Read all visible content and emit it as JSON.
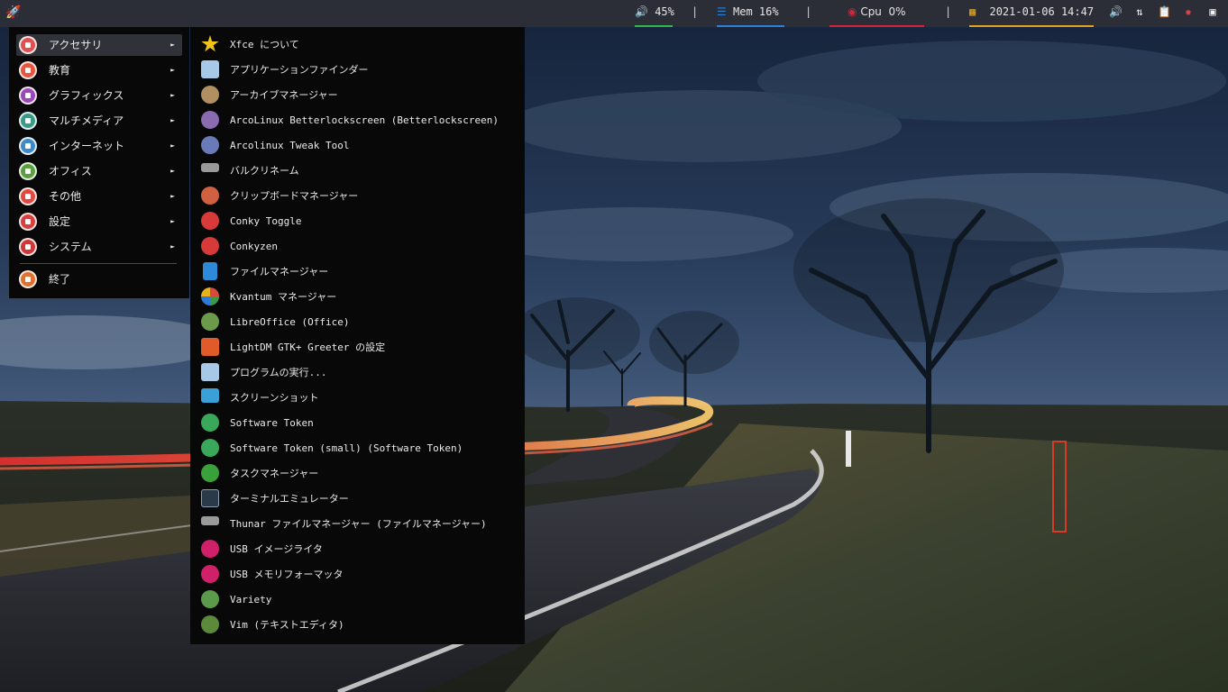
{
  "panel": {
    "volume": "45%",
    "memory": "Mem 16%",
    "cpu": "Cpu  0%",
    "clock": "2021-01-06 14:47",
    "separator": "|",
    "colors": {
      "volume": "#2dbb4a",
      "memory": "#2e7fd6",
      "cpu": "#d3243a",
      "clock": "#e0a220"
    }
  },
  "categories": [
    {
      "label": "アクセサリ",
      "icon": "accessories-icon",
      "color": "#e05050"
    },
    {
      "label": "教育",
      "icon": "education-icon",
      "color": "#e8553e"
    },
    {
      "label": "グラフィックス",
      "icon": "graphics-icon",
      "color": "#9a4ab8"
    },
    {
      "label": "マルチメディア",
      "icon": "multimedia-icon",
      "color": "#3a9a8a"
    },
    {
      "label": "インターネット",
      "icon": "internet-icon",
      "color": "#3e8ac8"
    },
    {
      "label": "オフィス",
      "icon": "office-icon",
      "color": "#5aa040"
    },
    {
      "label": "その他",
      "icon": "other-icon",
      "color": "#e04a40"
    },
    {
      "label": "設定",
      "icon": "settings-icon",
      "color": "#d84040"
    },
    {
      "label": "システム",
      "icon": "system-icon",
      "color": "#d03838"
    }
  ],
  "logout": {
    "label": "終了",
    "icon": "logout-icon",
    "color": "#e07030"
  },
  "arrow": "►",
  "apps": [
    {
      "label": "Xfce について",
      "icon": "star-icon",
      "color": "#f2c418"
    },
    {
      "label": "アプリケーションファインダー",
      "icon": "magnifier-icon",
      "color": "#a8c8e8"
    },
    {
      "label": "アーカイブマネージャー",
      "icon": "archive-icon",
      "color": "#b09060"
    },
    {
      "label": "ArcoLinux Betterlockscreen (Betterlockscreen)",
      "icon": "lock-icon",
      "color": "#8a6ab0"
    },
    {
      "label": "Arcolinux Tweak Tool",
      "icon": "tweak-tool-icon",
      "color": "#6a7ab8"
    },
    {
      "label": "バルクリネーム",
      "icon": "bulk-rename-icon",
      "color": "#9a9a9a"
    },
    {
      "label": "クリップボードマネージャー",
      "icon": "clipboard-icon",
      "color": "#d06040"
    },
    {
      "label": "Conky Toggle",
      "icon": "conky-icon",
      "color": "#d83a3a"
    },
    {
      "label": "Conkyzen",
      "icon": "conky-icon",
      "color": "#d83a3a"
    },
    {
      "label": "ファイルマネージャー",
      "icon": "file-manager-icon",
      "color": "#2d8ad8"
    },
    {
      "label": "Kvantum マネージャー",
      "icon": "kvantum-icon",
      "color": "#d84a3a"
    },
    {
      "label": "LibreOffice (Office)",
      "icon": "libreoffice-icon",
      "color": "#6a9a4a"
    },
    {
      "label": "LightDM GTK+ Greeter の設定",
      "icon": "lightdm-icon",
      "color": "#e05a2a"
    },
    {
      "label": "プログラムの実行...",
      "icon": "run-program-icon",
      "color": "#a8c8e8"
    },
    {
      "label": "スクリーンショット",
      "icon": "screenshot-icon",
      "color": "#3aa0d8"
    },
    {
      "label": "Software Token",
      "icon": "token-icon",
      "color": "#3aa85a"
    },
    {
      "label": "Software Token (small) (Software Token)",
      "icon": "token-icon",
      "color": "#3aa85a"
    },
    {
      "label": "タスクマネージャー",
      "icon": "task-manager-icon",
      "color": "#3aa03a"
    },
    {
      "label": "ターミナルエミュレーター",
      "icon": "terminal-icon",
      "color": "#2a3a48"
    },
    {
      "label": "Thunar ファイルマネージャー (ファイルマネージャー)",
      "icon": "thunar-icon",
      "color": "#9a9a9a"
    },
    {
      "label": "USB イメージライタ",
      "icon": "usb-writer-icon",
      "color": "#d0206a"
    },
    {
      "label": "USB メモリフォーマッタ",
      "icon": "usb-format-icon",
      "color": "#d0206a"
    },
    {
      "label": "Variety",
      "icon": "variety-icon",
      "color": "#5a9a4a"
    },
    {
      "label": "Vim (テキストエディタ)",
      "icon": "vim-icon",
      "color": "#5a8a3a"
    }
  ]
}
